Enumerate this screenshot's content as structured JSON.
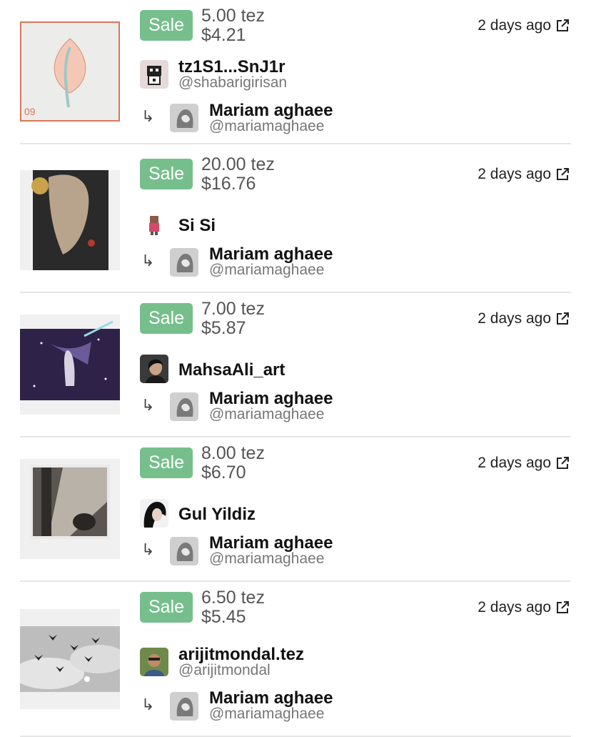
{
  "sales": [
    {
      "badge": "Sale",
      "price_tez": "5.00 tez",
      "price_usd": "$4.21",
      "time": "2 days ago",
      "seller": {
        "name": "tz1S1...SnJ1r",
        "handle": "@shabarigirisan"
      },
      "creator": {
        "arrow": "↳",
        "name": "Mariam aghaee",
        "handle": "@mariamaghaee"
      },
      "thumb_text": "09"
    },
    {
      "badge": "Sale",
      "price_tez": "20.00 tez",
      "price_usd": "$16.76",
      "time": "2 days ago",
      "seller": {
        "name": "Si Si",
        "handle": ""
      },
      "creator": {
        "arrow": "↳",
        "name": "Mariam aghaee",
        "handle": "@mariamaghaee"
      }
    },
    {
      "badge": "Sale",
      "price_tez": "7.00 tez",
      "price_usd": "$5.87",
      "time": "2 days ago",
      "seller": {
        "name": "MahsaAli_art",
        "handle": ""
      },
      "creator": {
        "arrow": "↳",
        "name": "Mariam aghaee",
        "handle": "@mariamaghaee"
      }
    },
    {
      "badge": "Sale",
      "price_tez": "8.00 tez",
      "price_usd": "$6.70",
      "time": "2 days ago",
      "seller": {
        "name": "Gul Yildiz",
        "handle": ""
      },
      "creator": {
        "arrow": "↳",
        "name": "Mariam aghaee",
        "handle": "@mariamaghaee"
      }
    },
    {
      "badge": "Sale",
      "price_tez": "6.50 tez",
      "price_usd": "$5.45",
      "time": "2 days ago",
      "seller": {
        "name": "arijitmondal.tez",
        "handle": "@arijitmondal"
      },
      "creator": {
        "arrow": "↳",
        "name": "Mariam aghaee",
        "handle": "@mariamaghaee"
      }
    }
  ],
  "colors": {
    "sale_badge": "#76bf8c",
    "price_text": "#555555",
    "handle_text": "#777777",
    "divider": "#e6e6e6"
  },
  "icons": {
    "external_link": "external-link-icon",
    "reply_arrow": "arrow-return-icon"
  }
}
